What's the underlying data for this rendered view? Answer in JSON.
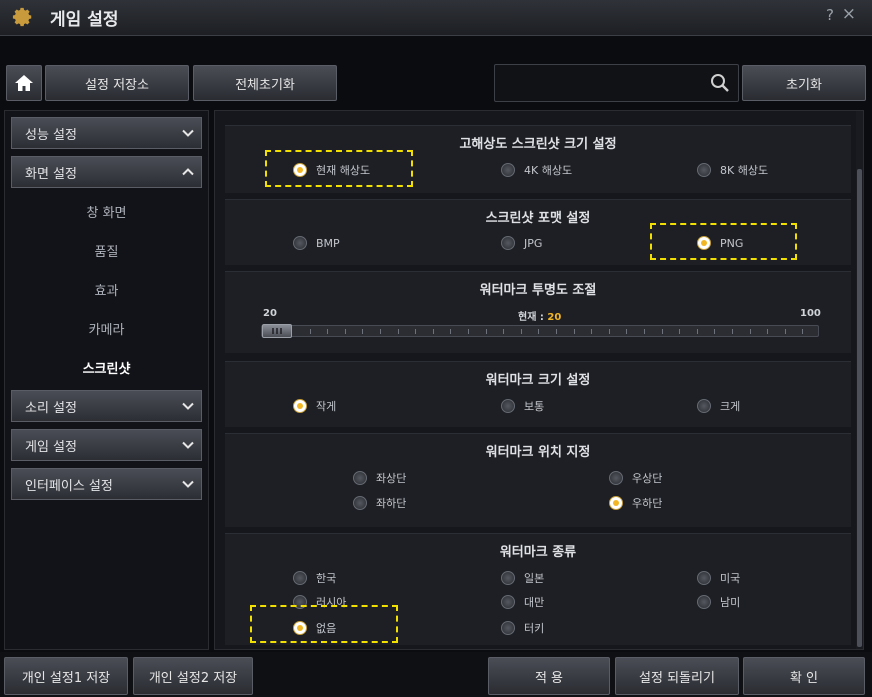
{
  "window": {
    "title": "게임 설정",
    "help": "?",
    "close": "×"
  },
  "toolbar": {
    "store": "설정 저장소",
    "reset_all": "전체초기화",
    "search_placeholder": "",
    "init": "초기화"
  },
  "sidebar": {
    "categories": [
      {
        "label": "성능 설정",
        "expanded": false
      },
      {
        "label": "화면 설정",
        "expanded": true
      },
      {
        "label": "소리 설정",
        "expanded": false
      },
      {
        "label": "게임 설정",
        "expanded": false
      },
      {
        "label": "인터페이스 설정",
        "expanded": false
      }
    ],
    "sub_items": [
      "창 화면",
      "품질",
      "효과",
      "카메라",
      "스크린샷"
    ],
    "active_sub": "스크린샷"
  },
  "sections": {
    "resolution": {
      "title": "고해상도 스크린샷 크기 설정",
      "options": [
        "현재 해상도",
        "4K 해상도",
        "8K 해상도"
      ],
      "selected": "현재 해상도"
    },
    "format": {
      "title": "스크린샷 포맷 설정",
      "options": [
        "BMP",
        "JPG",
        "PNG"
      ],
      "selected": "PNG"
    },
    "opacity": {
      "title": "워터마크 투명도 조절",
      "min": "20",
      "max": "100",
      "current_label": "현재 :",
      "current": "20",
      "value": 20
    },
    "wm_size": {
      "title": "워터마크 크기 설정",
      "options": [
        "작게",
        "보통",
        "크게"
      ],
      "selected": "작게"
    },
    "wm_position": {
      "title": "워터마크 위치 지정",
      "options": [
        "좌상단",
        "우상단",
        "좌하단",
        "우하단"
      ],
      "selected": "우하단"
    },
    "wm_type": {
      "title": "워터마크 종류",
      "options": [
        "한국",
        "일본",
        "미국",
        "러시아",
        "대만",
        "남미",
        "없음",
        "터키"
      ],
      "selected": "없음"
    }
  },
  "bottom": {
    "save1": "개인 설정1 저장",
    "save2": "개인 설정2 저장",
    "apply": "적 용",
    "revert": "설정 되돌리기",
    "confirm": "확 인"
  },
  "colors": {
    "accent": "#f2b625",
    "highlight_dash": "#f2e000"
  }
}
